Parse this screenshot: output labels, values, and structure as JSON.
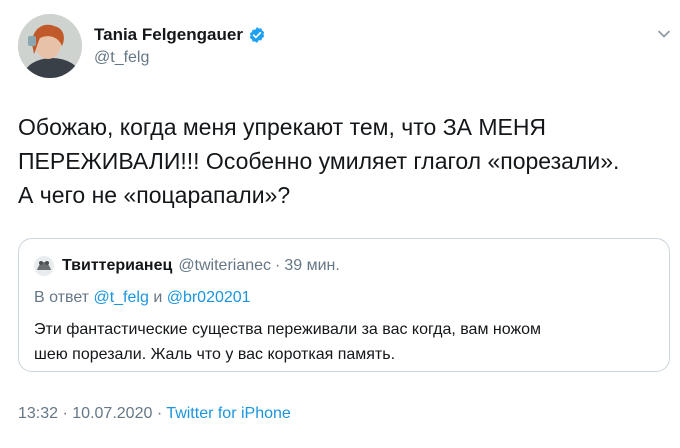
{
  "author": {
    "name": "Tania Felgengauer",
    "handle": "@t_felg",
    "verified": true,
    "avatar": "profile-photo"
  },
  "tweet": {
    "lines": [
      "Обожаю, когда меня упрекают тем, что ЗА МЕНЯ",
      "ПЕРЕЖИВАЛИ!!! Особенно умиляет глагол «порезали».",
      "А чего не «поцарапали»?"
    ]
  },
  "quoted_tweet": {
    "name": "Твиттерианец",
    "handle": "@twiterianec",
    "separator": "·",
    "time": "39 мин.",
    "reply_prefix": "В ответ",
    "reply_user1": "@t_felg",
    "reply_and": "и",
    "reply_user2": "@br020201",
    "text_lines": [
      "Эти фантастические существа переживали за вас когда, вам ножом",
      "шею порезали. Жаль что у вас короткая память."
    ]
  },
  "footer": {
    "time": "13:32",
    "sep1": "·",
    "date": "10.07.2020",
    "sep2": "·",
    "source": "Twitter for iPhone"
  },
  "colors": {
    "text": "#14171a",
    "secondary": "#657786",
    "link": "#1b95e0",
    "border": "#ccd6dd"
  }
}
